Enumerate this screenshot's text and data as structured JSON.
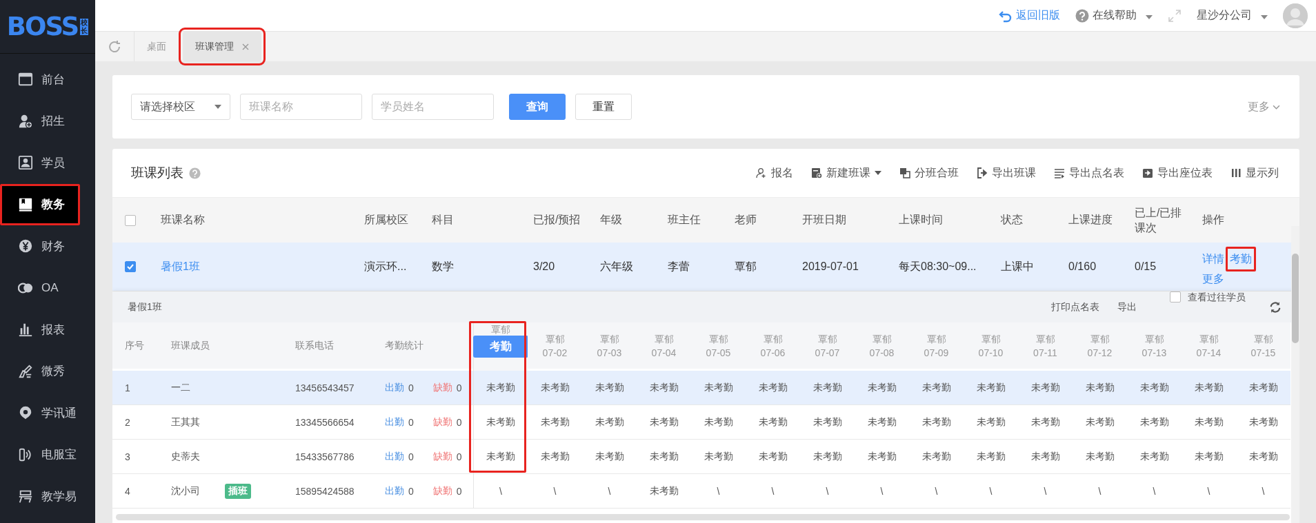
{
  "logo": {
    "text": "BOSS",
    "badge": "校长"
  },
  "header": {
    "back_link": "返回旧版",
    "help": "在线帮助",
    "branch": "星沙分公司"
  },
  "sidebar": {
    "items": [
      {
        "label": "前台",
        "selected": false,
        "highlighted": false
      },
      {
        "label": "招生",
        "selected": false,
        "highlighted": false
      },
      {
        "label": "学员",
        "selected": false,
        "highlighted": false
      },
      {
        "label": "教务",
        "selected": true,
        "highlighted": true
      },
      {
        "label": "财务",
        "selected": false,
        "highlighted": false
      },
      {
        "label": "OA",
        "selected": false,
        "highlighted": false
      },
      {
        "label": "报表",
        "selected": false,
        "highlighted": false
      },
      {
        "label": "微秀",
        "selected": false,
        "highlighted": false
      },
      {
        "label": "学讯通",
        "selected": false,
        "highlighted": false
      },
      {
        "label": "电服宝",
        "selected": false,
        "highlighted": false
      },
      {
        "label": "教学易",
        "selected": false,
        "highlighted": false
      }
    ]
  },
  "tabs": [
    {
      "label": "桌面",
      "selected": false,
      "closable": false,
      "highlighted": false
    },
    {
      "label": "班课管理",
      "selected": true,
      "closable": true,
      "highlighted": true
    }
  ],
  "filters": {
    "campus": {
      "placeholder": "请选择校区"
    },
    "class_name": {
      "placeholder": "班课名称"
    },
    "student_name": {
      "placeholder": "学员姓名"
    },
    "search_button": "查询",
    "reset_button": "重置",
    "more": "更多"
  },
  "class_list": {
    "title": "班课列表",
    "toolbar": [
      {
        "label": "报名",
        "dropdown": false
      },
      {
        "label": "新建班课",
        "dropdown": true
      },
      {
        "label": "分班合班",
        "dropdown": false
      },
      {
        "label": "导出班课",
        "dropdown": false
      },
      {
        "label": "导出点名表",
        "dropdown": false
      },
      {
        "label": "导出座位表",
        "dropdown": false
      },
      {
        "label": "显示列",
        "dropdown": false
      }
    ],
    "all_checked": false,
    "columns": [
      "班课名称",
      "所属校区",
      "科目",
      "已报/预招",
      "年级",
      "班主任",
      "老师",
      "开班日期",
      "上课时间",
      "状态",
      "上课进度",
      "已上/已排课次",
      "操作"
    ],
    "rows": [
      {
        "checked": true,
        "cells": [
          "暑假1班",
          "演示环...",
          "数学",
          "3/20",
          "六年级",
          "李蕾",
          "覃郁",
          "2019-07-01",
          "每天08:30~09...",
          "上课中",
          "0/160",
          "0/15"
        ],
        "actions": [
          {
            "label": "详情",
            "highlighted": false
          },
          {
            "label": "考勤",
            "highlighted": true
          },
          {
            "label": "更多",
            "highlighted": false
          }
        ]
      }
    ]
  },
  "attendance": {
    "title": "暑假1班",
    "print": "打印点名表",
    "export": "导出",
    "show_past": {
      "label": "查看过往学员",
      "checked": false
    },
    "columns": [
      "序号",
      "班课成员",
      "联系电话",
      "考勤统计"
    ],
    "date_columns": [
      {
        "teacher": "覃郁",
        "button": "考勤",
        "highlighted": true
      },
      {
        "teacher": "覃郁",
        "date": "07-02",
        "highlighted": false
      },
      {
        "teacher": "覃郁",
        "date": "07-03",
        "highlighted": false
      },
      {
        "teacher": "覃郁",
        "date": "07-04",
        "highlighted": false
      },
      {
        "teacher": "覃郁",
        "date": "07-05",
        "highlighted": false
      },
      {
        "teacher": "覃郁",
        "date": "07-06",
        "highlighted": false
      },
      {
        "teacher": "覃郁",
        "date": "07-07",
        "highlighted": false
      },
      {
        "teacher": "覃郁",
        "date": "07-08",
        "highlighted": false
      },
      {
        "teacher": "覃郁",
        "date": "07-09",
        "highlighted": false
      },
      {
        "teacher": "覃郁",
        "date": "07-10",
        "highlighted": false
      },
      {
        "teacher": "覃郁",
        "date": "07-11",
        "highlighted": false
      },
      {
        "teacher": "覃郁",
        "date": "07-12",
        "highlighted": false
      },
      {
        "teacher": "覃郁",
        "date": "07-13",
        "highlighted": false
      },
      {
        "teacher": "覃郁",
        "date": "07-14",
        "highlighted": false
      },
      {
        "teacher": "覃郁",
        "date": "07-15",
        "highlighted": false
      }
    ],
    "rows": [
      {
        "index": "1",
        "name": "一二",
        "phone": "13456543457",
        "present_label": "出勤",
        "present": "0",
        "absent_label": "缺勤",
        "absent": "0",
        "selected": true,
        "marks": [
          "未考勤",
          "未考勤",
          "未考勤",
          "未考勤",
          "未考勤",
          "未考勤",
          "未考勤",
          "未考勤",
          "未考勤",
          "未考勤",
          "未考勤",
          "未考勤",
          "未考勤",
          "未考勤",
          "未考勤"
        ]
      },
      {
        "index": "2",
        "name": "王其其",
        "phone": "13345566654",
        "present_label": "出勤",
        "present": "0",
        "absent_label": "缺勤",
        "absent": "0",
        "selected": false,
        "marks": [
          "未考勤",
          "未考勤",
          "未考勤",
          "未考勤",
          "未考勤",
          "未考勤",
          "未考勤",
          "未考勤",
          "未考勤",
          "未考勤",
          "未考勤",
          "未考勤",
          "未考勤",
          "未考勤",
          "未考勤"
        ]
      },
      {
        "index": "3",
        "name": "史蒂夫",
        "phone": "15433567786",
        "present_label": "出勤",
        "present": "0",
        "absent_label": "缺勤",
        "absent": "0",
        "selected": false,
        "marks": [
          "未考勤",
          "未考勤",
          "未考勤",
          "未考勤",
          "未考勤",
          "未考勤",
          "未考勤",
          "未考勤",
          "未考勤",
          "未考勤",
          "未考勤",
          "未考勤",
          "未考勤",
          "未考勤",
          "未考勤"
        ]
      },
      {
        "index": "4",
        "name": "沈小司",
        "tag": "插班",
        "phone": "15895424588",
        "present_label": "出勤",
        "present": "0",
        "absent_label": "缺勤",
        "absent": "0",
        "selected": false,
        "marks": [
          "\\",
          "\\",
          "\\",
          "未考勤",
          "\\",
          "\\",
          "\\",
          "\\",
          "\\",
          "\\",
          "\\",
          "\\",
          "\\",
          "\\",
          "\\"
        ]
      }
    ]
  }
}
